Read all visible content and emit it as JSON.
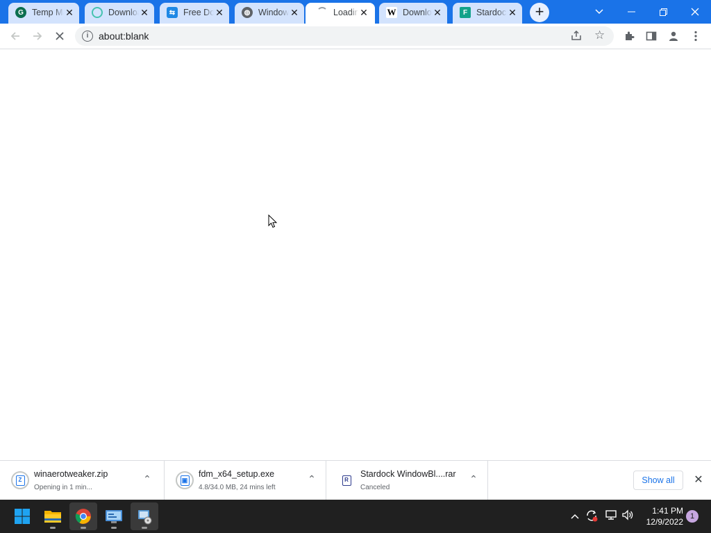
{
  "colors": {
    "tab_strip": "#1a73e8",
    "accent": "#1a73e8",
    "taskbar": "#202020"
  },
  "tabs": [
    {
      "title": "Temp Mail",
      "icon": "temp-mail-favicon",
      "active": false
    },
    {
      "title": "Download",
      "icon": "download-favicon",
      "active": false
    },
    {
      "title": "Free Download Manager",
      "icon": "fdm-favicon",
      "active": false
    },
    {
      "title": "Windows",
      "icon": "globe-favicon",
      "active": false
    },
    {
      "title": "Loading",
      "icon": "loading-spinner-icon",
      "active": true
    },
    {
      "title": "Download",
      "icon": "w-favicon",
      "active": false
    },
    {
      "title": "Stardock",
      "icon": "stardock-favicon",
      "active": false
    }
  ],
  "toolbar": {
    "url": "about:blank"
  },
  "downloads": [
    {
      "name": "winaerotweaker.zip",
      "status": "Opening in 1 min...",
      "icon": "zip-file-icon",
      "glyph": "Z"
    },
    {
      "name": "fdm_x64_setup.exe",
      "status": "4.8/34.0 MB, 24 mins left",
      "icon": "exe-file-icon",
      "glyph": "▣"
    },
    {
      "name": "Stardock WindowBl....rar",
      "status": "Canceled",
      "icon": "rar-file-icon",
      "glyph": "R"
    }
  ],
  "shelf": {
    "show_all": "Show all"
  },
  "taskbar": {
    "apps": [
      {
        "name": "start-button",
        "icon": "windows-logo-icon"
      },
      {
        "name": "file-explorer",
        "icon": "folder-icon"
      },
      {
        "name": "chrome",
        "icon": "chrome-icon"
      },
      {
        "name": "control-panel",
        "icon": "control-panel-icon"
      },
      {
        "name": "setup-app",
        "icon": "installer-icon"
      }
    ],
    "time": "1:41 PM",
    "date": "12/9/2022",
    "notifications": "1"
  }
}
